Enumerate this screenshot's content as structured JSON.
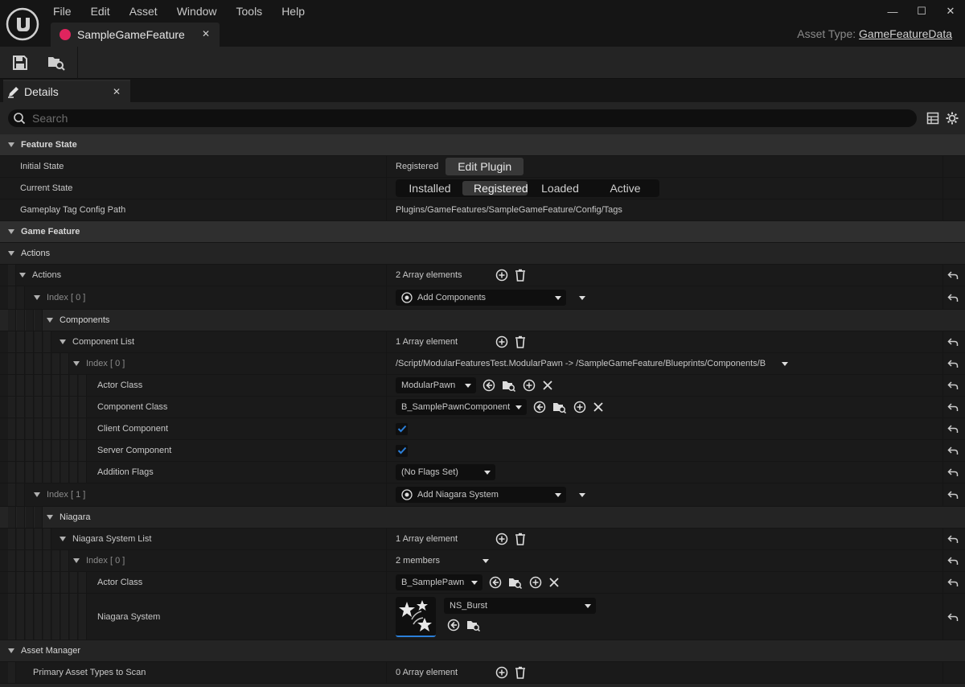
{
  "menu": [
    "File",
    "Edit",
    "Asset",
    "Window",
    "Tools",
    "Help"
  ],
  "doc_tab": {
    "title": "SampleGameFeature",
    "close": "✕"
  },
  "window_controls": [
    "—",
    "☐",
    "✕"
  ],
  "asset_type": {
    "label": "Asset Type:",
    "value": "GameFeatureData"
  },
  "details_tab": {
    "title": "Details",
    "close": "✕"
  },
  "search": {
    "placeholder": "Search"
  },
  "sections": {
    "feature_state": "Feature State",
    "game_feature": "Game Feature",
    "actions_cat": "Actions",
    "asset_manager": "Asset Manager"
  },
  "feature_state": {
    "initial_state_label": "Initial State",
    "initial_state_value": "Registered",
    "edit_plugin": "Edit Plugin",
    "current_state_label": "Current State",
    "states": [
      "Installed",
      "Registered",
      "Loaded",
      "Active"
    ],
    "current_state": "Registered",
    "tag_path_label": "Gameplay Tag Config Path",
    "tag_path_value": "Plugins/GameFeatures/SampleGameFeature/Config/Tags"
  },
  "actions": {
    "label": "Actions",
    "count": "2 Array elements",
    "index0": {
      "label": "Index [ 0 ]",
      "type": "Add Components",
      "components_label": "Components",
      "component_list_label": "Component List",
      "component_list_count": "1 Array element",
      "entry_label": "Index [ 0 ]",
      "entry_value": "/Script/ModularFeaturesTest.ModularPawn -> /SampleGameFeature/Blueprints/Components/B_S",
      "actor_class_label": "Actor Class",
      "actor_class_value": "ModularPawn",
      "component_class_label": "Component Class",
      "component_class_value": "B_SamplePawnComponent",
      "client_label": "Client Component",
      "client_checked": true,
      "server_label": "Server Component",
      "server_checked": true,
      "flags_label": "Addition Flags",
      "flags_value": "(No Flags Set)"
    },
    "index1": {
      "label": "Index [ 1 ]",
      "type": "Add Niagara System",
      "niagara_label": "Niagara",
      "system_list_label": "Niagara System List",
      "system_list_count": "1 Array element",
      "entry_label": "Index [ 0 ]",
      "entry_members": "2 members",
      "actor_class_label": "Actor Class",
      "actor_class_value": "B_SamplePawn",
      "niagara_system_label": "Niagara System",
      "niagara_system_value": "NS_Burst"
    }
  },
  "asset_manager": {
    "primary_label": "Primary Asset Types to Scan",
    "primary_count": "0 Array element"
  },
  "colors": {
    "accent": "#2b7fd9",
    "tab_dot": "#e0245e",
    "bg": "#242424"
  }
}
